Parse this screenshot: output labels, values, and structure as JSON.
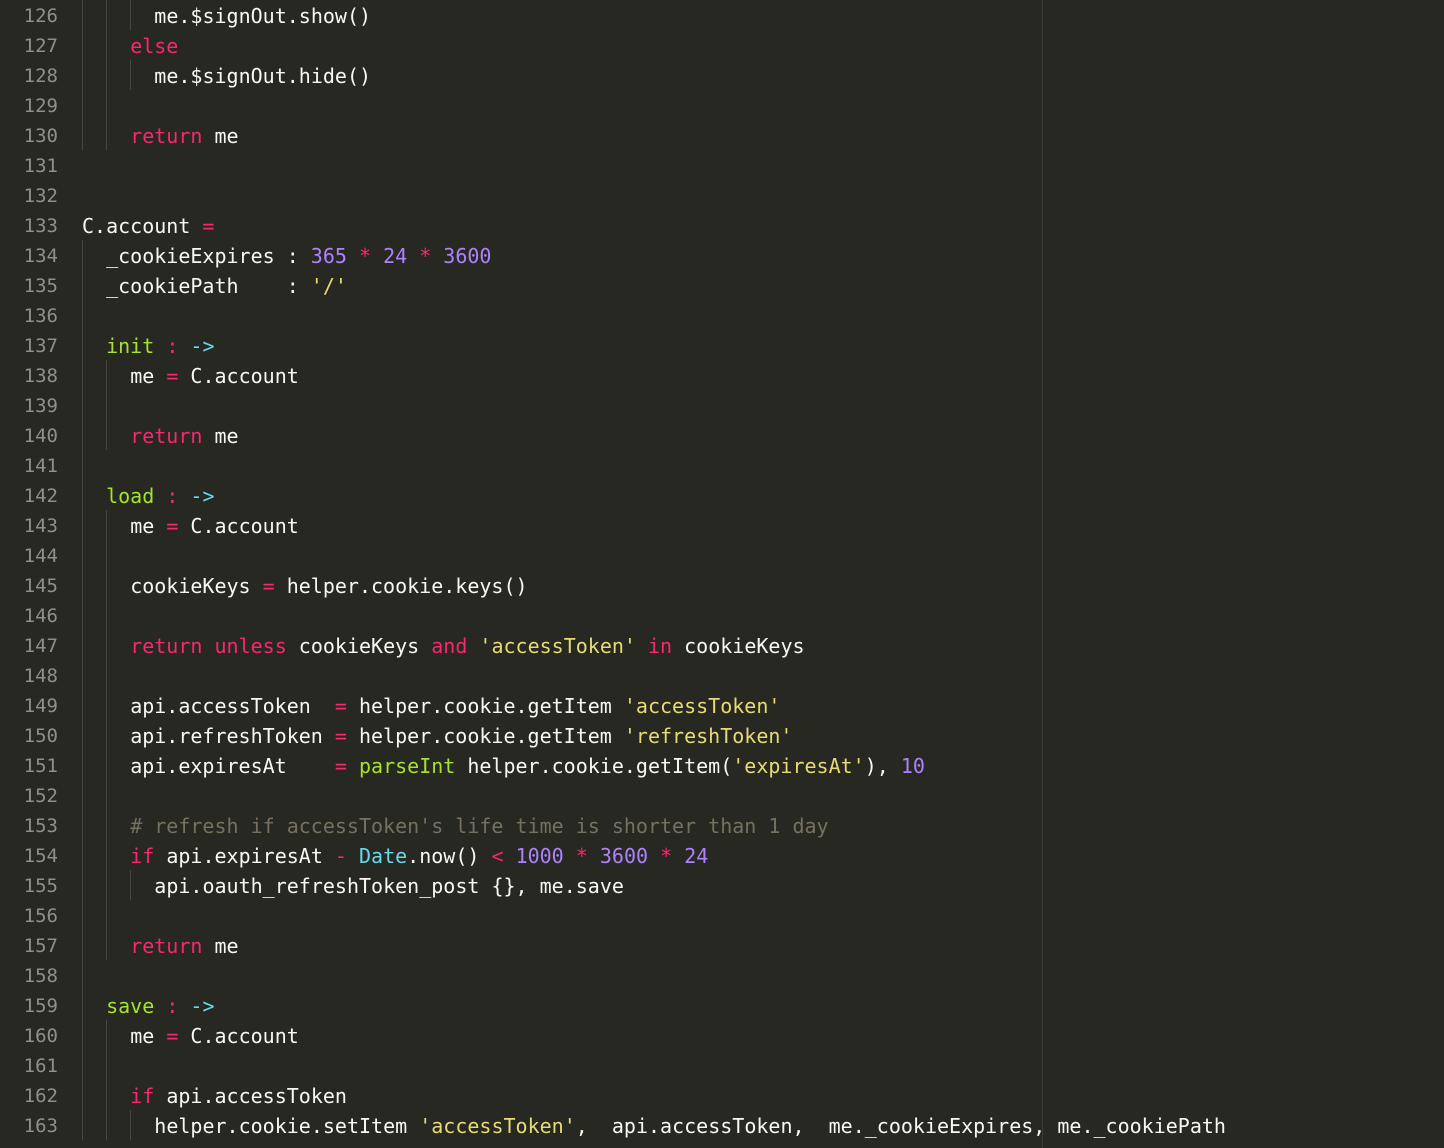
{
  "editor": {
    "theme_colors": {
      "background": "#272822",
      "foreground": "#f8f8f2",
      "keyword": "#f92672",
      "function": "#a6e22e",
      "number": "#ae81ff",
      "string": "#e6db74",
      "builtin": "#66d9ef",
      "comment": "#75715e",
      "line_number": "#90908a"
    },
    "lines": [
      {
        "n": "126",
        "indent": 6,
        "tokens": [
          {
            "t": "me.$signOut.show()",
            "c": "plain"
          }
        ]
      },
      {
        "n": "127",
        "indent": 4,
        "tokens": [
          {
            "t": "else",
            "c": "kw"
          }
        ]
      },
      {
        "n": "128",
        "indent": 6,
        "tokens": [
          {
            "t": "me.$signOut.hide()",
            "c": "plain"
          }
        ]
      },
      {
        "n": "129",
        "indent": 0,
        "tokens": []
      },
      {
        "n": "130",
        "indent": 4,
        "tokens": [
          {
            "t": "return",
            "c": "kw"
          },
          {
            "t": " me",
            "c": "plain"
          }
        ]
      },
      {
        "n": "131",
        "indent": 0,
        "tokens": []
      },
      {
        "n": "132",
        "indent": 0,
        "tokens": []
      },
      {
        "n": "133",
        "indent": 0,
        "tokens": [
          {
            "t": "C.account ",
            "c": "plain"
          },
          {
            "t": "=",
            "c": "op"
          }
        ]
      },
      {
        "n": "134",
        "indent": 2,
        "tokens": [
          {
            "t": "_cookieExpires : ",
            "c": "plain"
          },
          {
            "t": "365",
            "c": "num"
          },
          {
            "t": " ",
            "c": "plain"
          },
          {
            "t": "*",
            "c": "op"
          },
          {
            "t": " ",
            "c": "plain"
          },
          {
            "t": "24",
            "c": "num"
          },
          {
            "t": " ",
            "c": "plain"
          },
          {
            "t": "*",
            "c": "op"
          },
          {
            "t": " ",
            "c": "plain"
          },
          {
            "t": "3600",
            "c": "num"
          }
        ]
      },
      {
        "n": "135",
        "indent": 2,
        "tokens": [
          {
            "t": "_cookiePath    : ",
            "c": "plain"
          },
          {
            "t": "'/'",
            "c": "str"
          }
        ]
      },
      {
        "n": "136",
        "indent": 0,
        "tokens": []
      },
      {
        "n": "137",
        "indent": 2,
        "tokens": [
          {
            "t": "init",
            "c": "fn"
          },
          {
            "t": " ",
            "c": "plain"
          },
          {
            "t": ":",
            "c": "op"
          },
          {
            "t": " ",
            "c": "plain"
          },
          {
            "t": "->",
            "c": "arrow"
          }
        ]
      },
      {
        "n": "138",
        "indent": 4,
        "tokens": [
          {
            "t": "me ",
            "c": "plain"
          },
          {
            "t": "=",
            "c": "op"
          },
          {
            "t": " C.account",
            "c": "plain"
          }
        ]
      },
      {
        "n": "139",
        "indent": 0,
        "tokens": []
      },
      {
        "n": "140",
        "indent": 4,
        "tokens": [
          {
            "t": "return",
            "c": "kw"
          },
          {
            "t": " me",
            "c": "plain"
          }
        ]
      },
      {
        "n": "141",
        "indent": 0,
        "tokens": []
      },
      {
        "n": "142",
        "indent": 2,
        "tokens": [
          {
            "t": "load",
            "c": "fn"
          },
          {
            "t": " ",
            "c": "plain"
          },
          {
            "t": ":",
            "c": "op"
          },
          {
            "t": " ",
            "c": "plain"
          },
          {
            "t": "->",
            "c": "arrow"
          }
        ]
      },
      {
        "n": "143",
        "indent": 4,
        "tokens": [
          {
            "t": "me ",
            "c": "plain"
          },
          {
            "t": "=",
            "c": "op"
          },
          {
            "t": " C.account",
            "c": "plain"
          }
        ]
      },
      {
        "n": "144",
        "indent": 0,
        "tokens": []
      },
      {
        "n": "145",
        "indent": 4,
        "tokens": [
          {
            "t": "cookieKeys ",
            "c": "plain"
          },
          {
            "t": "=",
            "c": "op"
          },
          {
            "t": " helper.cookie.keys()",
            "c": "plain"
          }
        ]
      },
      {
        "n": "146",
        "indent": 0,
        "tokens": []
      },
      {
        "n": "147",
        "indent": 4,
        "tokens": [
          {
            "t": "return",
            "c": "kw"
          },
          {
            "t": " ",
            "c": "plain"
          },
          {
            "t": "unless",
            "c": "kw"
          },
          {
            "t": " cookieKeys ",
            "c": "plain"
          },
          {
            "t": "and",
            "c": "kw"
          },
          {
            "t": " ",
            "c": "plain"
          },
          {
            "t": "'accessToken'",
            "c": "str"
          },
          {
            "t": " ",
            "c": "plain"
          },
          {
            "t": "in",
            "c": "kw"
          },
          {
            "t": " cookieKeys",
            "c": "plain"
          }
        ]
      },
      {
        "n": "148",
        "indent": 0,
        "tokens": []
      },
      {
        "n": "149",
        "indent": 4,
        "tokens": [
          {
            "t": "api.accessToken  ",
            "c": "plain"
          },
          {
            "t": "=",
            "c": "op"
          },
          {
            "t": " helper.cookie.getItem ",
            "c": "plain"
          },
          {
            "t": "'accessToken'",
            "c": "str"
          }
        ]
      },
      {
        "n": "150",
        "indent": 4,
        "tokens": [
          {
            "t": "api.refreshToken ",
            "c": "plain"
          },
          {
            "t": "=",
            "c": "op"
          },
          {
            "t": " helper.cookie.getItem ",
            "c": "plain"
          },
          {
            "t": "'refreshToken'",
            "c": "str"
          }
        ]
      },
      {
        "n": "151",
        "indent": 4,
        "tokens": [
          {
            "t": "api.expiresAt    ",
            "c": "plain"
          },
          {
            "t": "=",
            "c": "op"
          },
          {
            "t": " ",
            "c": "plain"
          },
          {
            "t": "parseInt",
            "c": "fn"
          },
          {
            "t": " helper.cookie.getItem(",
            "c": "plain"
          },
          {
            "t": "'expiresAt'",
            "c": "str"
          },
          {
            "t": "), ",
            "c": "plain"
          },
          {
            "t": "10",
            "c": "num"
          }
        ]
      },
      {
        "n": "152",
        "indent": 0,
        "tokens": []
      },
      {
        "n": "153",
        "indent": 4,
        "tokens": [
          {
            "t": "# refresh if accessToken's life time is shorter than 1 day",
            "c": "cm"
          }
        ]
      },
      {
        "n": "154",
        "indent": 4,
        "tokens": [
          {
            "t": "if",
            "c": "kw"
          },
          {
            "t": " api.expiresAt ",
            "c": "plain"
          },
          {
            "t": "-",
            "c": "op"
          },
          {
            "t": " ",
            "c": "plain"
          },
          {
            "t": "Date",
            "c": "cls"
          },
          {
            "t": ".now() ",
            "c": "plain"
          },
          {
            "t": "<",
            "c": "op"
          },
          {
            "t": " ",
            "c": "plain"
          },
          {
            "t": "1000",
            "c": "num"
          },
          {
            "t": " ",
            "c": "plain"
          },
          {
            "t": "*",
            "c": "op"
          },
          {
            "t": " ",
            "c": "plain"
          },
          {
            "t": "3600",
            "c": "num"
          },
          {
            "t": " ",
            "c": "plain"
          },
          {
            "t": "*",
            "c": "op"
          },
          {
            "t": " ",
            "c": "plain"
          },
          {
            "t": "24",
            "c": "num"
          }
        ]
      },
      {
        "n": "155",
        "indent": 6,
        "tokens": [
          {
            "t": "api.oauth_refreshToken_post {}, me.save",
            "c": "plain"
          }
        ]
      },
      {
        "n": "156",
        "indent": 0,
        "tokens": []
      },
      {
        "n": "157",
        "indent": 4,
        "tokens": [
          {
            "t": "return",
            "c": "kw"
          },
          {
            "t": " me",
            "c": "plain"
          }
        ]
      },
      {
        "n": "158",
        "indent": 0,
        "tokens": []
      },
      {
        "n": "159",
        "indent": 2,
        "tokens": [
          {
            "t": "save",
            "c": "fn"
          },
          {
            "t": " ",
            "c": "plain"
          },
          {
            "t": ":",
            "c": "op"
          },
          {
            "t": " ",
            "c": "plain"
          },
          {
            "t": "->",
            "c": "arrow"
          }
        ]
      },
      {
        "n": "160",
        "indent": 4,
        "tokens": [
          {
            "t": "me ",
            "c": "plain"
          },
          {
            "t": "=",
            "c": "op"
          },
          {
            "t": " C.account",
            "c": "plain"
          }
        ]
      },
      {
        "n": "161",
        "indent": 0,
        "tokens": []
      },
      {
        "n": "162",
        "indent": 4,
        "tokens": [
          {
            "t": "if",
            "c": "kw"
          },
          {
            "t": " api.accessToken",
            "c": "plain"
          }
        ]
      },
      {
        "n": "163",
        "indent": 6,
        "tokens": [
          {
            "t": "helper.cookie.setItem ",
            "c": "plain"
          },
          {
            "t": "'accessToken'",
            "c": "str"
          },
          {
            "t": ",  api.accessToken,  me._cookieExpires, me._cookiePath",
            "c": "plain"
          }
        ]
      }
    ]
  }
}
